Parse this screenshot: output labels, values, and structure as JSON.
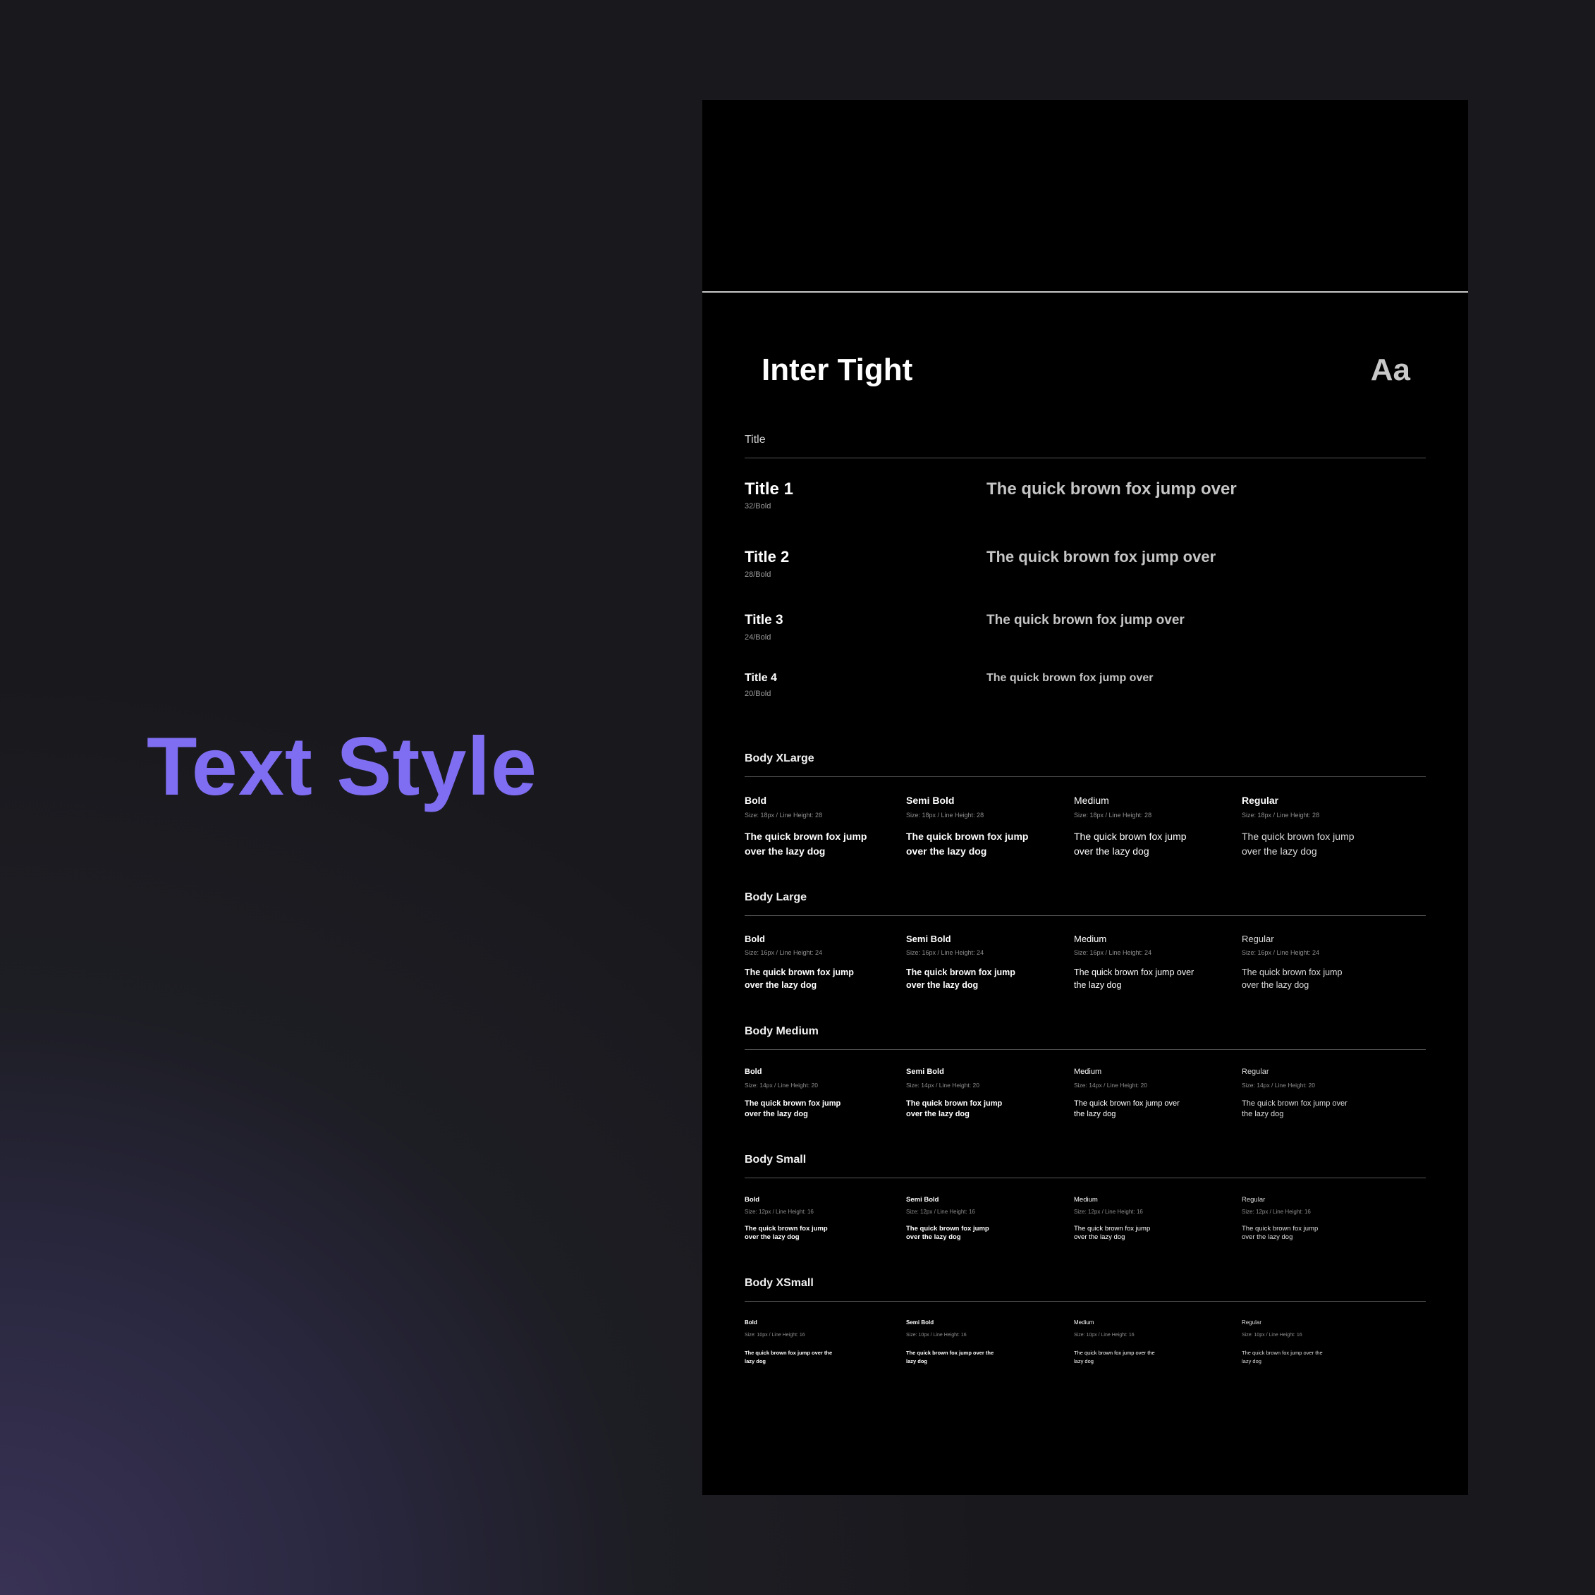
{
  "hero": {
    "title": "Text Style"
  },
  "panel": {
    "font_name": "Inter Tight",
    "font_sample": "Aa",
    "title_section": {
      "label": "Title",
      "rows": [
        {
          "name": "Title 1",
          "spec": "32/Bold",
          "sample": "The quick brown fox jump over"
        },
        {
          "name": "Title 2",
          "spec": "28/Bold",
          "sample": "The quick brown fox jump over"
        },
        {
          "name": "Title 3",
          "spec": "24/Bold",
          "sample": "The quick brown fox jump over"
        },
        {
          "name": "Title 4",
          "spec": "20/Bold",
          "sample": "The quick brown fox jump over"
        }
      ]
    },
    "body_sections": [
      {
        "label": "Body XLarge",
        "weights": [
          {
            "name": "Bold",
            "spec": "Size: 18px / Line Height: 28",
            "sample": "The quick brown fox jump over the lazy dog"
          },
          {
            "name": "Semi Bold",
            "spec": "Size: 18px / Line Height: 28",
            "sample": "The quick brown fox jump over the lazy dog"
          },
          {
            "name": "Medium",
            "spec": "Size: 18px / Line Height: 28",
            "sample": "The quick brown fox jump over the lazy dog"
          },
          {
            "name": "Regular",
            "spec": "Size: 18px / Line Height: 28",
            "sample": "The quick brown fox jump over the lazy dog"
          }
        ]
      },
      {
        "label": "Body Large",
        "weights": [
          {
            "name": "Bold",
            "spec": "Size: 16px / Line Height: 24",
            "sample": "The quick brown fox jump over the lazy dog"
          },
          {
            "name": "Semi Bold",
            "spec": "Size: 16px / Line Height: 24",
            "sample": "The quick brown fox jump over the lazy dog"
          },
          {
            "name": "Medium",
            "spec": "Size: 16px / Line Height: 24",
            "sample": "The quick brown fox jump over the lazy dog"
          },
          {
            "name": "Regular",
            "spec": "Size: 16px / Line Height: 24",
            "sample": "The quick brown fox jump over the lazy dog"
          }
        ]
      },
      {
        "label": "Body Medium",
        "weights": [
          {
            "name": "Bold",
            "spec": "Size: 14px / Line Height: 20",
            "sample": "The quick brown fox jump over the lazy dog"
          },
          {
            "name": "Semi Bold",
            "spec": "Size: 14px / Line Height: 20",
            "sample": "The quick brown fox jump over the lazy dog"
          },
          {
            "name": "Medium",
            "spec": "Size: 14px / Line Height: 20",
            "sample": "The quick brown fox jump over the lazy dog"
          },
          {
            "name": "Regular",
            "spec": "Size: 14px / Line Height: 20",
            "sample": "The quick brown fox jump over the lazy dog"
          }
        ]
      },
      {
        "label": "Body Small",
        "weights": [
          {
            "name": "Bold",
            "spec": "Size: 12px / Line Height: 16",
            "sample": "The quick brown fox jump over the lazy dog"
          },
          {
            "name": "Semi Bold",
            "spec": "Size: 12px / Line Height: 16",
            "sample": "The quick brown fox jump over the lazy dog"
          },
          {
            "name": "Medium",
            "spec": "Size: 12px / Line Height: 16",
            "sample": "The quick brown fox jump over the lazy dog"
          },
          {
            "name": "Regular",
            "spec": "Size: 12px / Line Height: 16",
            "sample": "The quick brown fox jump over the lazy dog"
          }
        ]
      },
      {
        "label": "Body XSmall",
        "weights": [
          {
            "name": "Bold",
            "spec": "Size: 10px / Line Height: 16",
            "sample": "The quick brown fox jump over the lazy dog"
          },
          {
            "name": "Semi Bold",
            "spec": "Size: 10px / Line Height: 16",
            "sample": "The quick brown fox jump over the lazy dog"
          },
          {
            "name": "Medium",
            "spec": "Size: 10px / Line Height: 16",
            "sample": "The quick brown fox jump over the lazy dog"
          },
          {
            "name": "Regular",
            "spec": "Size: 10px / Line Height: 16",
            "sample": "The quick brown fox jump over the lazy dog"
          }
        ]
      }
    ]
  },
  "colors": {
    "accent": "#7f6ef2",
    "panel_bg": "#000000"
  }
}
